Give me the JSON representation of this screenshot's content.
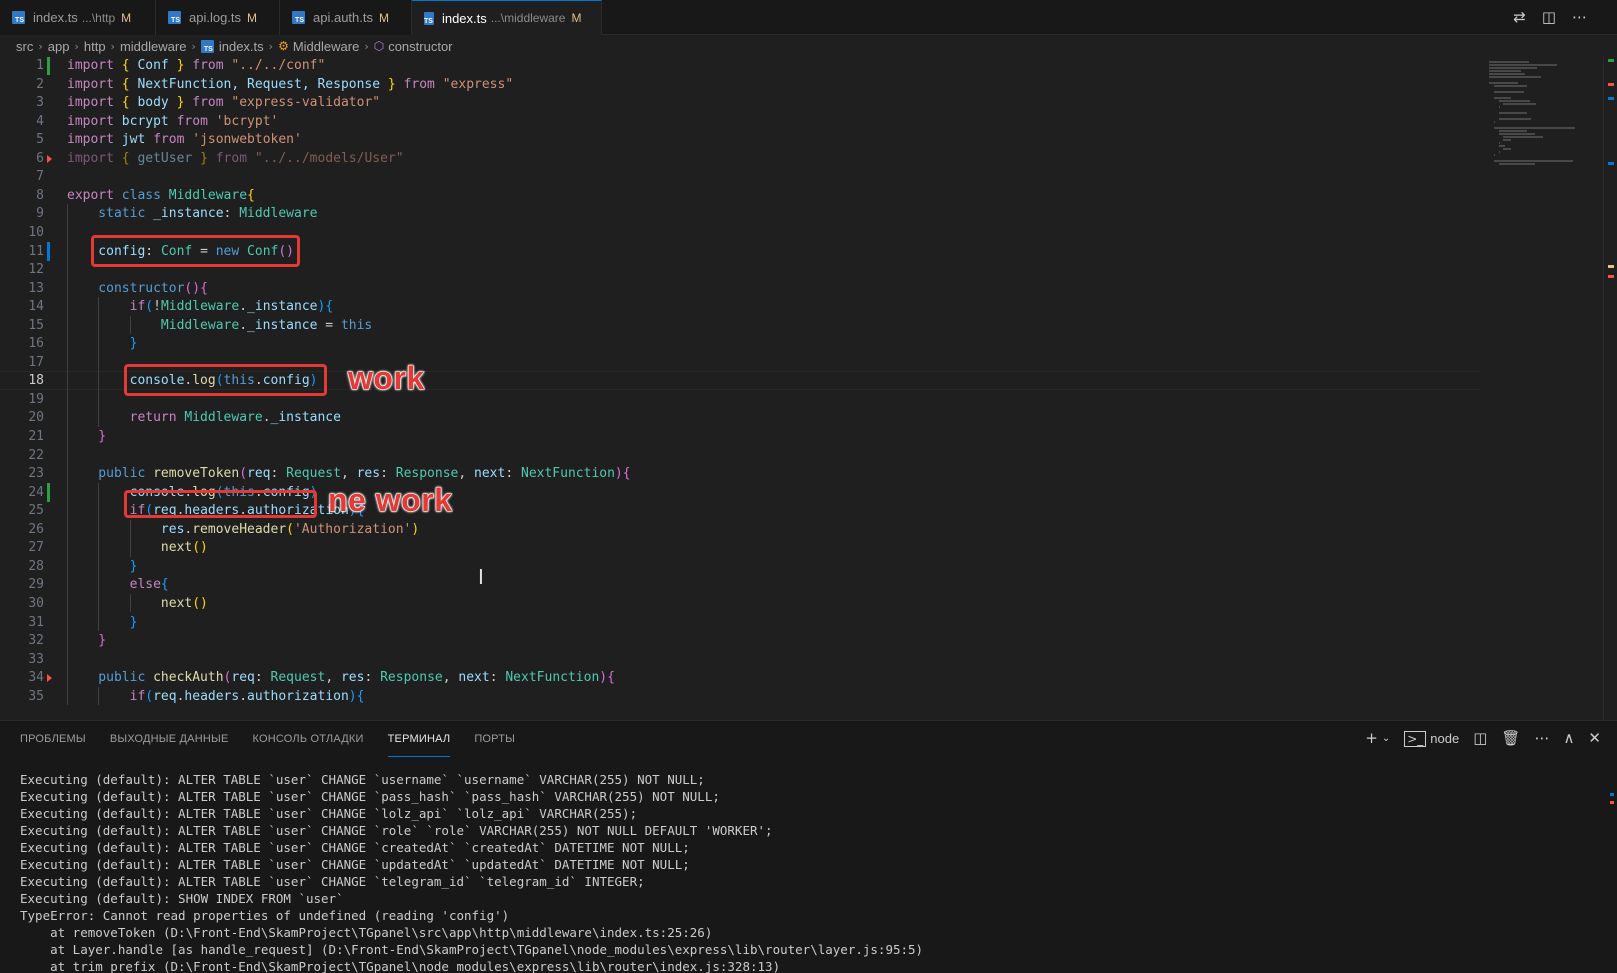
{
  "tabs": [
    {
      "label": "index.ts",
      "desc": "...\\http",
      "status": "M",
      "active": false,
      "icon": "TS"
    },
    {
      "label": "api.log.ts",
      "desc": "",
      "status": "M",
      "active": false,
      "icon": "TS"
    },
    {
      "label": "api.auth.ts",
      "desc": "",
      "status": "M",
      "active": false,
      "icon": "TS"
    },
    {
      "label": "index.ts",
      "desc": "...\\middleware",
      "status": "M",
      "active": true,
      "icon": "TS"
    }
  ],
  "tab_actions": [
    {
      "name": "compare-changes-icon",
      "glyph": "⇄"
    },
    {
      "name": "split-editor-icon",
      "glyph": "◫"
    },
    {
      "name": "more-actions-icon",
      "glyph": "⋯"
    }
  ],
  "breadcrumb": {
    "items": [
      "src",
      "app",
      "http",
      "middleware"
    ],
    "file": "index.ts",
    "class": "Middleware",
    "method": "constructor"
  },
  "editor": {
    "current_line": 18,
    "lines": [
      [
        {
          "t": "import ",
          "c": "kw"
        },
        {
          "t": "{ ",
          "c": "br1"
        },
        {
          "t": "Conf",
          "c": "var"
        },
        {
          "t": " } ",
          "c": "br1"
        },
        {
          "t": "from ",
          "c": "kw"
        },
        {
          "t": "\"../../conf\"",
          "c": "str"
        }
      ],
      [
        {
          "t": "import ",
          "c": "kw"
        },
        {
          "t": "{ ",
          "c": "br1"
        },
        {
          "t": "NextFunction, Request, Response",
          "c": "var"
        },
        {
          "t": " } ",
          "c": "br1"
        },
        {
          "t": "from ",
          "c": "kw"
        },
        {
          "t": "\"express\"",
          "c": "str"
        }
      ],
      [
        {
          "t": "import ",
          "c": "kw"
        },
        {
          "t": "{ ",
          "c": "br1"
        },
        {
          "t": "body",
          "c": "var"
        },
        {
          "t": " } ",
          "c": "br1"
        },
        {
          "t": "from ",
          "c": "kw"
        },
        {
          "t": "\"express-validator\"",
          "c": "str"
        }
      ],
      [
        {
          "t": "import ",
          "c": "kw"
        },
        {
          "t": "bcrypt ",
          "c": "var"
        },
        {
          "t": "from ",
          "c": "kw"
        },
        {
          "t": "'bcrypt'",
          "c": "str"
        }
      ],
      [
        {
          "t": "import ",
          "c": "kw"
        },
        {
          "t": "jwt ",
          "c": "var"
        },
        {
          "t": "from ",
          "c": "kw"
        },
        {
          "t": "'jsonwebtoken'",
          "c": "str"
        }
      ],
      [
        {
          "t": "import ",
          "c": "kw dim"
        },
        {
          "t": "{ ",
          "c": "br1 dim"
        },
        {
          "t": "getUser",
          "c": "var dim"
        },
        {
          "t": " } ",
          "c": "br1 dim"
        },
        {
          "t": "from ",
          "c": "kw dim"
        },
        {
          "t": "\"../../models/User\"",
          "c": "str dim"
        }
      ],
      [],
      [
        {
          "t": "export ",
          "c": "kw"
        },
        {
          "t": "class ",
          "c": "kw2"
        },
        {
          "t": "Middleware",
          "c": "cls"
        },
        {
          "t": "{",
          "c": "br1"
        }
      ],
      [
        {
          "t": "    static ",
          "c": "kw2"
        },
        {
          "t": "_instance",
          "c": "var"
        },
        {
          "t": ": ",
          "c": ""
        },
        {
          "t": "Middleware",
          "c": "cls"
        }
      ],
      [],
      [
        {
          "t": "    config",
          "c": "var"
        },
        {
          "t": ": ",
          "c": ""
        },
        {
          "t": "Conf",
          "c": "cls"
        },
        {
          "t": " = ",
          "c": ""
        },
        {
          "t": "new ",
          "c": "kw2"
        },
        {
          "t": "Conf",
          "c": "cls"
        },
        {
          "t": "()",
          "c": "br2"
        }
      ],
      [],
      [
        {
          "t": "    constructor",
          "c": "kw2"
        },
        {
          "t": "()",
          "c": "br2"
        },
        {
          "t": "{",
          "c": "br2"
        }
      ],
      [
        {
          "t": "        if",
          "c": "kw"
        },
        {
          "t": "(",
          "c": "br3"
        },
        {
          "t": "!",
          "c": ""
        },
        {
          "t": "Middleware",
          "c": "cls"
        },
        {
          "t": ".",
          "c": ""
        },
        {
          "t": "_instance",
          "c": "var"
        },
        {
          "t": ")",
          "c": "br3"
        },
        {
          "t": "{",
          "c": "br3"
        }
      ],
      [
        {
          "t": "            Middleware",
          "c": "cls"
        },
        {
          "t": ".",
          "c": ""
        },
        {
          "t": "_instance",
          "c": "var"
        },
        {
          "t": " = ",
          "c": ""
        },
        {
          "t": "this",
          "c": "kw2"
        }
      ],
      [
        {
          "t": "        }",
          "c": "br3"
        }
      ],
      [],
      [
        {
          "t": "        console",
          "c": "var"
        },
        {
          "t": ".",
          "c": ""
        },
        {
          "t": "log",
          "c": "fn"
        },
        {
          "t": "(",
          "c": "br3"
        },
        {
          "t": "this",
          "c": "kw2"
        },
        {
          "t": ".",
          "c": ""
        },
        {
          "t": "config",
          "c": "var"
        },
        {
          "t": ")",
          "c": "br3"
        }
      ],
      [],
      [
        {
          "t": "        return ",
          "c": "kw"
        },
        {
          "t": "Middleware",
          "c": "cls"
        },
        {
          "t": ".",
          "c": ""
        },
        {
          "t": "_instance",
          "c": "var"
        }
      ],
      [
        {
          "t": "    }",
          "c": "br2"
        }
      ],
      [],
      [
        {
          "t": "    public ",
          "c": "kw2"
        },
        {
          "t": "removeToken",
          "c": "fn"
        },
        {
          "t": "(",
          "c": "br2"
        },
        {
          "t": "req",
          "c": "var"
        },
        {
          "t": ": ",
          "c": ""
        },
        {
          "t": "Request",
          "c": "cls"
        },
        {
          "t": ", ",
          "c": ""
        },
        {
          "t": "res",
          "c": "var"
        },
        {
          "t": ": ",
          "c": ""
        },
        {
          "t": "Response",
          "c": "cls"
        },
        {
          "t": ", ",
          "c": ""
        },
        {
          "t": "next",
          "c": "var"
        },
        {
          "t": ": ",
          "c": ""
        },
        {
          "t": "NextFunction",
          "c": "cls"
        },
        {
          "t": ")",
          "c": "br2"
        },
        {
          "t": "{",
          "c": "br2"
        }
      ],
      [
        {
          "t": "        console",
          "c": "var"
        },
        {
          "t": ".",
          "c": ""
        },
        {
          "t": "log",
          "c": "fn"
        },
        {
          "t": "(",
          "c": "br3"
        },
        {
          "t": "this",
          "c": "kw2"
        },
        {
          "t": ".",
          "c": ""
        },
        {
          "t": "config",
          "c": "var"
        },
        {
          "t": ")",
          "c": "br3"
        }
      ],
      [
        {
          "t": "        if",
          "c": "kw"
        },
        {
          "t": "(",
          "c": "br3"
        },
        {
          "t": "req",
          "c": "var"
        },
        {
          "t": ".",
          "c": ""
        },
        {
          "t": "headers",
          "c": "var"
        },
        {
          "t": ".",
          "c": ""
        },
        {
          "t": "authorization",
          "c": "var"
        },
        {
          "t": ")",
          "c": "br3"
        },
        {
          "t": "{",
          "c": "br3"
        }
      ],
      [
        {
          "t": "            res",
          "c": "var"
        },
        {
          "t": ".",
          "c": ""
        },
        {
          "t": "removeHeader",
          "c": "fn"
        },
        {
          "t": "(",
          "c": "br1"
        },
        {
          "t": "'Authorization'",
          "c": "str"
        },
        {
          "t": ")",
          "c": "br1"
        }
      ],
      [
        {
          "t": "            next",
          "c": "fn"
        },
        {
          "t": "()",
          "c": "br1"
        }
      ],
      [
        {
          "t": "        }",
          "c": "br3"
        }
      ],
      [
        {
          "t": "        else",
          "c": "kw"
        },
        {
          "t": "{",
          "c": "br3"
        }
      ],
      [
        {
          "t": "            next",
          "c": "fn"
        },
        {
          "t": "()",
          "c": "br1"
        }
      ],
      [
        {
          "t": "        }",
          "c": "br3"
        }
      ],
      [
        {
          "t": "    }",
          "c": "br2"
        }
      ],
      [],
      [
        {
          "t": "    public ",
          "c": "kw2"
        },
        {
          "t": "checkAuth",
          "c": "fn"
        },
        {
          "t": "(",
          "c": "br2"
        },
        {
          "t": "req",
          "c": "var"
        },
        {
          "t": ": ",
          "c": ""
        },
        {
          "t": "Request",
          "c": "cls"
        },
        {
          "t": ", ",
          "c": ""
        },
        {
          "t": "res",
          "c": "var"
        },
        {
          "t": ": ",
          "c": ""
        },
        {
          "t": "Response",
          "c": "cls"
        },
        {
          "t": ", ",
          "c": ""
        },
        {
          "t": "next",
          "c": "var"
        },
        {
          "t": ": ",
          "c": ""
        },
        {
          "t": "NextFunction",
          "c": "cls"
        },
        {
          "t": ")",
          "c": "br2"
        },
        {
          "t": "{",
          "c": "br2"
        }
      ],
      [
        {
          "t": "        if",
          "c": "kw"
        },
        {
          "t": "(",
          "c": "br3"
        },
        {
          "t": "req",
          "c": "var"
        },
        {
          "t": ".",
          "c": ""
        },
        {
          "t": "headers",
          "c": "var"
        },
        {
          "t": ".",
          "c": ""
        },
        {
          "t": "authorization",
          "c": "var"
        },
        {
          "t": ")",
          "c": "br3"
        },
        {
          "t": "{",
          "c": "br3"
        }
      ]
    ]
  },
  "annotations": {
    "work": "work",
    "ne_work": "ne work"
  },
  "panel": {
    "tabs": [
      "ПРОБЛЕМЫ",
      "ВЫХОДНЫЕ ДАННЫЕ",
      "КОНСОЛЬ ОТЛАДКИ",
      "ТЕРМИНАЛ",
      "ПОРТЫ"
    ],
    "active_tab": "ТЕРМИНАЛ",
    "shell_label": "node",
    "terminal_lines": [
      "Executing (default): ALTER TABLE `user` CHANGE `username` `username` VARCHAR(255) NOT NULL;",
      "Executing (default): ALTER TABLE `user` CHANGE `pass_hash` `pass_hash` VARCHAR(255) NOT NULL;",
      "Executing (default): ALTER TABLE `user` CHANGE `lolz_api` `lolz_api` VARCHAR(255);",
      "Executing (default): ALTER TABLE `user` CHANGE `role` `role` VARCHAR(255) NOT NULL DEFAULT 'WORKER';",
      "Executing (default): ALTER TABLE `user` CHANGE `createdAt` `createdAt` DATETIME NOT NULL;",
      "Executing (default): ALTER TABLE `user` CHANGE `updatedAt` `updatedAt` DATETIME NOT NULL;",
      "Executing (default): ALTER TABLE `user` CHANGE `telegram_id` `telegram_id` INTEGER;",
      "Executing (default): SHOW INDEX FROM `user`",
      "TypeError: Cannot read properties of undefined (reading 'config')",
      "    at removeToken (D:\\Front-End\\SkamProject\\TGpanel\\src\\app\\http\\middleware\\index.ts:25:26)",
      "    at Layer.handle [as handle_request] (D:\\Front-End\\SkamProject\\TGpanel\\node_modules\\express\\lib\\router\\layer.js:95:5)",
      "    at trim_prefix (D:\\Front-End\\SkamProject\\TGpanel\\node_modules\\express\\lib\\router\\index.js:328:13)"
    ]
  },
  "colors": {
    "accent": "#0078d4",
    "annotation_red": "#e53935",
    "git_added": "#2ea043",
    "git_modified": "#0078d4",
    "git_deleted": "#f85149"
  }
}
